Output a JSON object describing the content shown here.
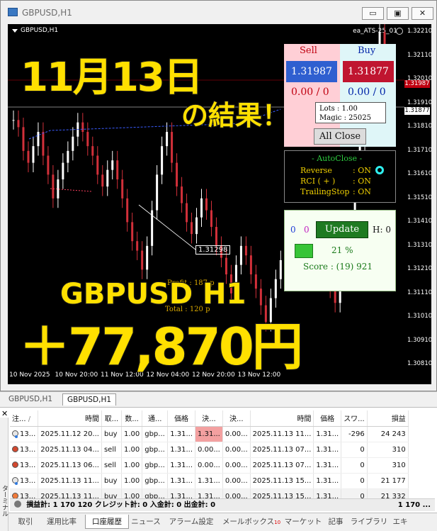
{
  "window": {
    "title": "GBPUSD,H1",
    "btn_min": "▭",
    "btn_max": "▣",
    "btn_close": "✕"
  },
  "chart": {
    "symbol": "GBPUSD,H1",
    "ea_name": "ea_ATS-25_01",
    "y_labels": [
      "1.32210",
      "1.32110",
      "1.32010",
      "1.31910",
      "1.31810",
      "1.31710",
      "1.31610",
      "1.31510",
      "1.31410",
      "1.31310",
      "1.31210",
      "1.31110",
      "1.31010",
      "1.30910",
      "1.30810"
    ],
    "bid_tag": "1.31987",
    "ask_tag": "1.31877",
    "x_labels": [
      "10 Nov 2025",
      "10 Nov 20:00",
      "11 Nov 12:00",
      "12 Nov 04:00",
      "12 Nov 20:00",
      "13 Nov 12:00"
    ],
    "price_label": "1.31298",
    "profit_label": "Profit : 187 p",
    "total_label": "Total : 120 p",
    "overlay_date": "11月13日",
    "overlay_result": "の結果！",
    "overlay_pair": "GBPUSD H1",
    "overlay_amount": "＋77,870円"
  },
  "panel": {
    "sell_label": "Sell",
    "buy_label": "Buy",
    "sell_price": "1.31987",
    "buy_price": "1.31877",
    "sell_pos": "0.00 / 0",
    "buy_pos": "0.00 / 0",
    "lots": "Lots   : 1.00",
    "magic": "Magic : 25025",
    "all_close": "All Close"
  },
  "autoclose": {
    "title": "- AutoClose -",
    "rows": [
      {
        "label": "Reverse",
        "value": ": ON"
      },
      {
        "label": "RCI  ( + )",
        "value": ": ON"
      },
      {
        "label": "TrailingStop",
        "value": ": ON"
      }
    ]
  },
  "update": {
    "left0": "0",
    "left1": "0",
    "button": "Update",
    "h": "H: 0",
    "pct": "21 %",
    "score": "Score : (19) 921"
  },
  "chart_tabs": [
    "GBPUSD,H1",
    "GBPUSD,H1"
  ],
  "table": {
    "headers": [
      "注...",
      "/",
      "時間",
      "取...",
      "数...",
      "通...",
      "価格",
      "決...",
      "決...",
      "時間",
      "価格",
      "スワ...",
      "損益"
    ],
    "rows": [
      [
        "13...",
        "2025.11.12 20...",
        "buy",
        "1.00",
        "gbp...",
        "1.31...",
        "1.31...",
        "0.00...",
        "2025.11.13 11...",
        "1.31...",
        "-296",
        "24 243"
      ],
      [
        "13...",
        "2025.11.13 04...",
        "sell",
        "1.00",
        "gbp...",
        "1.31...",
        "0.00...",
        "0.00...",
        "2025.11.13 07...",
        "1.31...",
        "0",
        "310"
      ],
      [
        "13...",
        "2025.11.13 06...",
        "sell",
        "1.00",
        "gbp...",
        "1.31...",
        "0.00...",
        "0.00...",
        "2025.11.13 07...",
        "1.31...",
        "0",
        "310"
      ],
      [
        "13...",
        "2025.11.13 11...",
        "buy",
        "1.00",
        "gbp...",
        "1.31...",
        "1.31...",
        "0.00...",
        "2025.11.13 15...",
        "1.31...",
        "0",
        "21 177"
      ],
      [
        "13...",
        "2025.11.13 11...",
        "buy",
        "1.00",
        "gbp...",
        "1.31...",
        "1.31...",
        "0.00...",
        "2025.11.13 15...",
        "1.31...",
        "0",
        "21 332"
      ]
    ],
    "summary": "損益計: 1 170 120  クレジット計: 0  入金計: 0  出金計: 0",
    "summary_right": "1 170 ..."
  },
  "terminal_side": "ターミナル",
  "bottom_tabs": [
    "取引",
    "運用比率",
    "口座履歴",
    "ニュース",
    "アラーム設定",
    "メールボックス",
    "マーケット",
    "記事",
    "ライブラリ",
    "エキ"
  ],
  "mail_badge": "10",
  "colors": {
    "sell": "#c00010",
    "buy": "#0024a8",
    "overlay": "#ffe000",
    "up": "#ffffff",
    "down": "#d2303a"
  }
}
